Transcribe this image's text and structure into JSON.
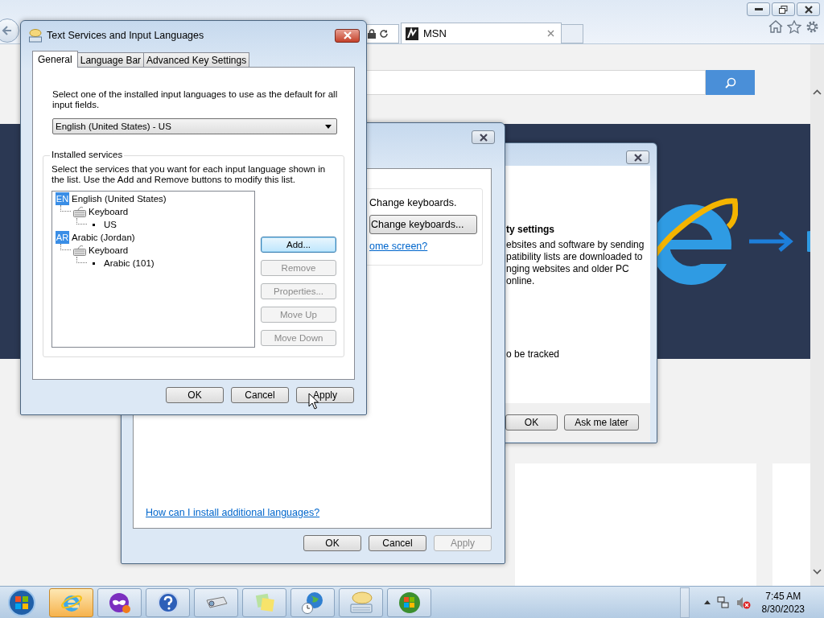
{
  "browser": {
    "tab_title": "MSN"
  },
  "privacy_dialog": {
    "heading": "ty settings",
    "body_lines": [
      "ebsites and software by sending",
      "patibility lists are downloaded to",
      "nging websites and older PC",
      "online."
    ],
    "note": "o be tracked",
    "buttons": [
      {
        "label": "OK"
      },
      {
        "label": "Ask me later"
      }
    ]
  },
  "region_dialog": {
    "text": "Change keyboards.",
    "button": "Change keyboards...",
    "link": "ome screen?",
    "help_link": "How can I install additional languages?",
    "buttons": [
      {
        "label": "OK",
        "disabled": false
      },
      {
        "label": "Cancel",
        "disabled": false
      },
      {
        "label": "Apply",
        "disabled": true
      }
    ]
  },
  "language_dialog": {
    "title": "Text Services and Input Languages",
    "tabs": [
      {
        "label": "General",
        "selected": true
      },
      {
        "label": "Language Bar",
        "selected": false
      },
      {
        "label": "Advanced Key Settings",
        "selected": false
      }
    ],
    "instruction": "Select one of the installed input languages to use as the default for all input fields.",
    "default_language": "English (United States) - US",
    "services_label": "Installed services",
    "services_description": "Select the services that you want for each input language shown in the list. Use the Add and Remove buttons to modify this list.",
    "tree": [
      {
        "kind": "language",
        "badge": "EN",
        "label": "English (United States)",
        "children": [
          {
            "kind": "category",
            "label": "Keyboard",
            "children": [
              {
                "kind": "layout",
                "label": "US"
              }
            ]
          }
        ]
      },
      {
        "kind": "language",
        "badge": "AR",
        "label": "Arabic (Jordan)",
        "children": [
          {
            "kind": "category",
            "label": "Keyboard",
            "children": [
              {
                "kind": "layout",
                "label": "Arabic (101)"
              }
            ]
          }
        ]
      }
    ],
    "side_buttons": [
      {
        "label": "Add...",
        "disabled": false,
        "focused": true
      },
      {
        "label": "Remove",
        "disabled": true,
        "focused": false
      },
      {
        "label": "Properties...",
        "disabled": true,
        "focused": false
      },
      {
        "label": "Move Up",
        "disabled": true,
        "focused": false
      },
      {
        "label": "Move Down",
        "disabled": true,
        "focused": false
      }
    ],
    "buttons": [
      {
        "label": "OK"
      },
      {
        "label": "Cancel"
      },
      {
        "label": "Apply"
      }
    ]
  },
  "taskbar": {
    "items": [
      {
        "kind": "browser",
        "active": true
      },
      {
        "kind": "mask",
        "active": false
      },
      {
        "kind": "help",
        "active": false
      },
      {
        "kind": "projector",
        "active": false
      },
      {
        "kind": "notes",
        "active": false
      },
      {
        "kind": "globe",
        "active": false
      },
      {
        "kind": "keyboard",
        "active": false
      },
      {
        "kind": "orb",
        "active": false
      }
    ],
    "time": "7:45 AM",
    "date": "8/30/2023"
  }
}
